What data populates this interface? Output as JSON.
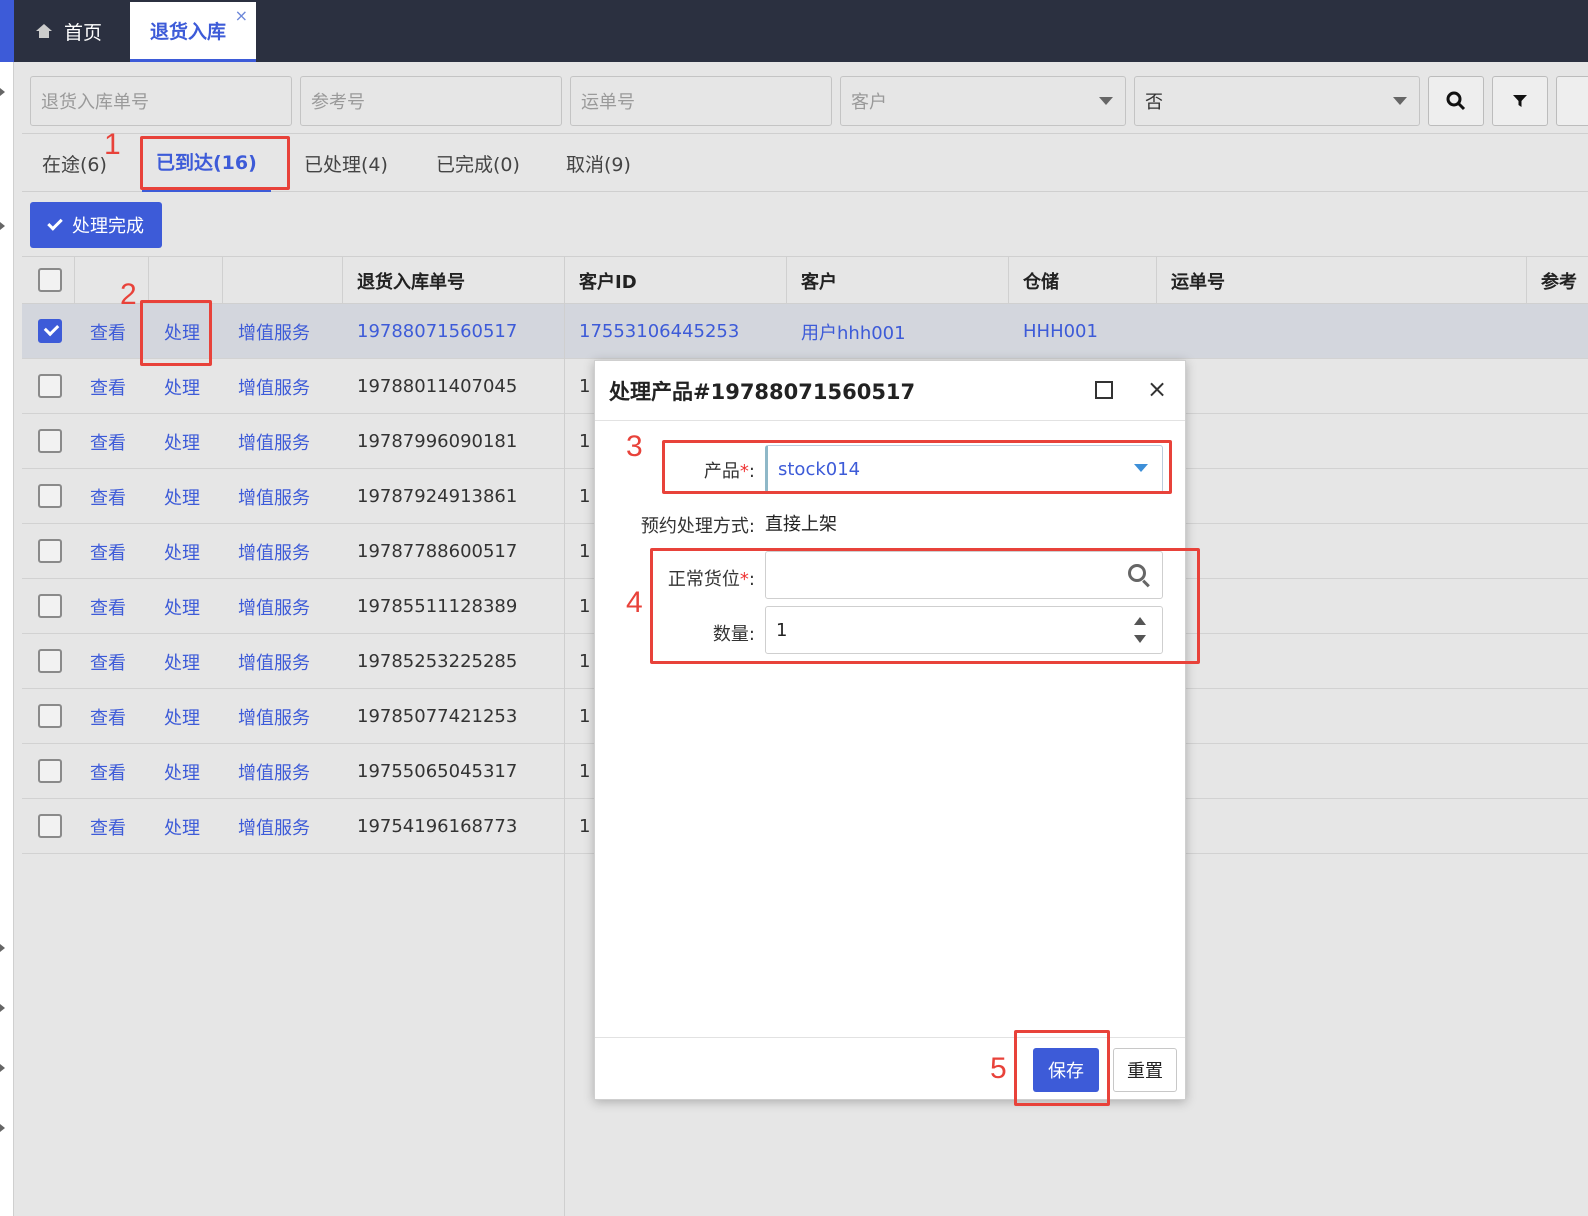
{
  "tabs": {
    "home": "首页",
    "active": "退货入库",
    "close": "×"
  },
  "filters": {
    "return_no": "退货入库单号",
    "ref_no": "参考号",
    "waybill": "运单号",
    "customer": "客户",
    "yesno": "否"
  },
  "status_tabs": [
    "在途(6)",
    "已到达(16)",
    "已处理(4)",
    "已完成(0)",
    "取消(9)"
  ],
  "done_button": "处理完成",
  "table": {
    "headers": [
      "退货入库单号",
      "客户ID",
      "客户",
      "仓储",
      "运单号",
      "参考"
    ],
    "actions": {
      "view": "查看",
      "process": "处理",
      "vas": "增值服务"
    },
    "first_row": {
      "customer_id": "17553106445253",
      "customer": "用户hhh001",
      "warehouse": "HHH001"
    },
    "order_nos": [
      "19788071560517",
      "19788011407045",
      "19787996090181",
      "19787924913861",
      "19787788600517",
      "19785511128389",
      "19785253225285",
      "19785077421253",
      "19755065045317",
      "19754196168773"
    ],
    "clipped_prefix": "1"
  },
  "dialog": {
    "title": "处理产品#19788071560517",
    "product_label": "产品",
    "product_value": "stock014",
    "method_label": "预约处理方式:",
    "method_value": "直接上架",
    "location_label": "正常货位",
    "location_value": "",
    "qty_label": "数量:",
    "qty_value": "1",
    "required_mark": "*",
    "colon": ":",
    "save": "保存",
    "reset": "重置"
  },
  "annotations": [
    "1",
    "2",
    "3",
    "4",
    "5"
  ],
  "colors": {
    "accent": "#3d5bd8",
    "annotation": "#e8423a",
    "topbar": "#2b3040"
  }
}
